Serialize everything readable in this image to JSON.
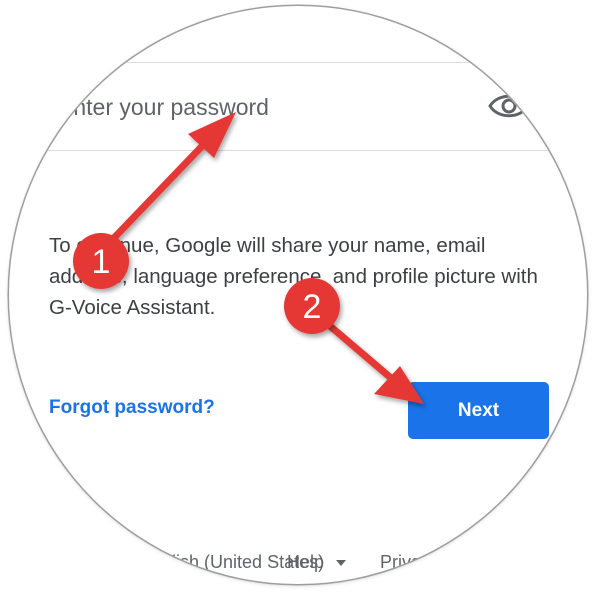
{
  "password_field": {
    "placeholder": "Enter your password"
  },
  "consent_text": "To continue, Google will share your name, email address, language preference, and profile picture with G-Voice Assistant.",
  "forgot_password_label": "Forgot password?",
  "next_label": "Next",
  "footer": {
    "language_selected": "English (United States)",
    "help_label": "Help",
    "privacy_label": "Privacy"
  },
  "annotations": {
    "step_1": "1",
    "step_2": "2"
  },
  "colors": {
    "accent": "#1a73e8",
    "annotation_red": "#e53935",
    "text": "#3c4043",
    "muted": "#5f6368"
  },
  "icons": {
    "eye": "eye-icon",
    "dropdown": "chevron-down-icon",
    "arrow": "arrow-icon"
  }
}
